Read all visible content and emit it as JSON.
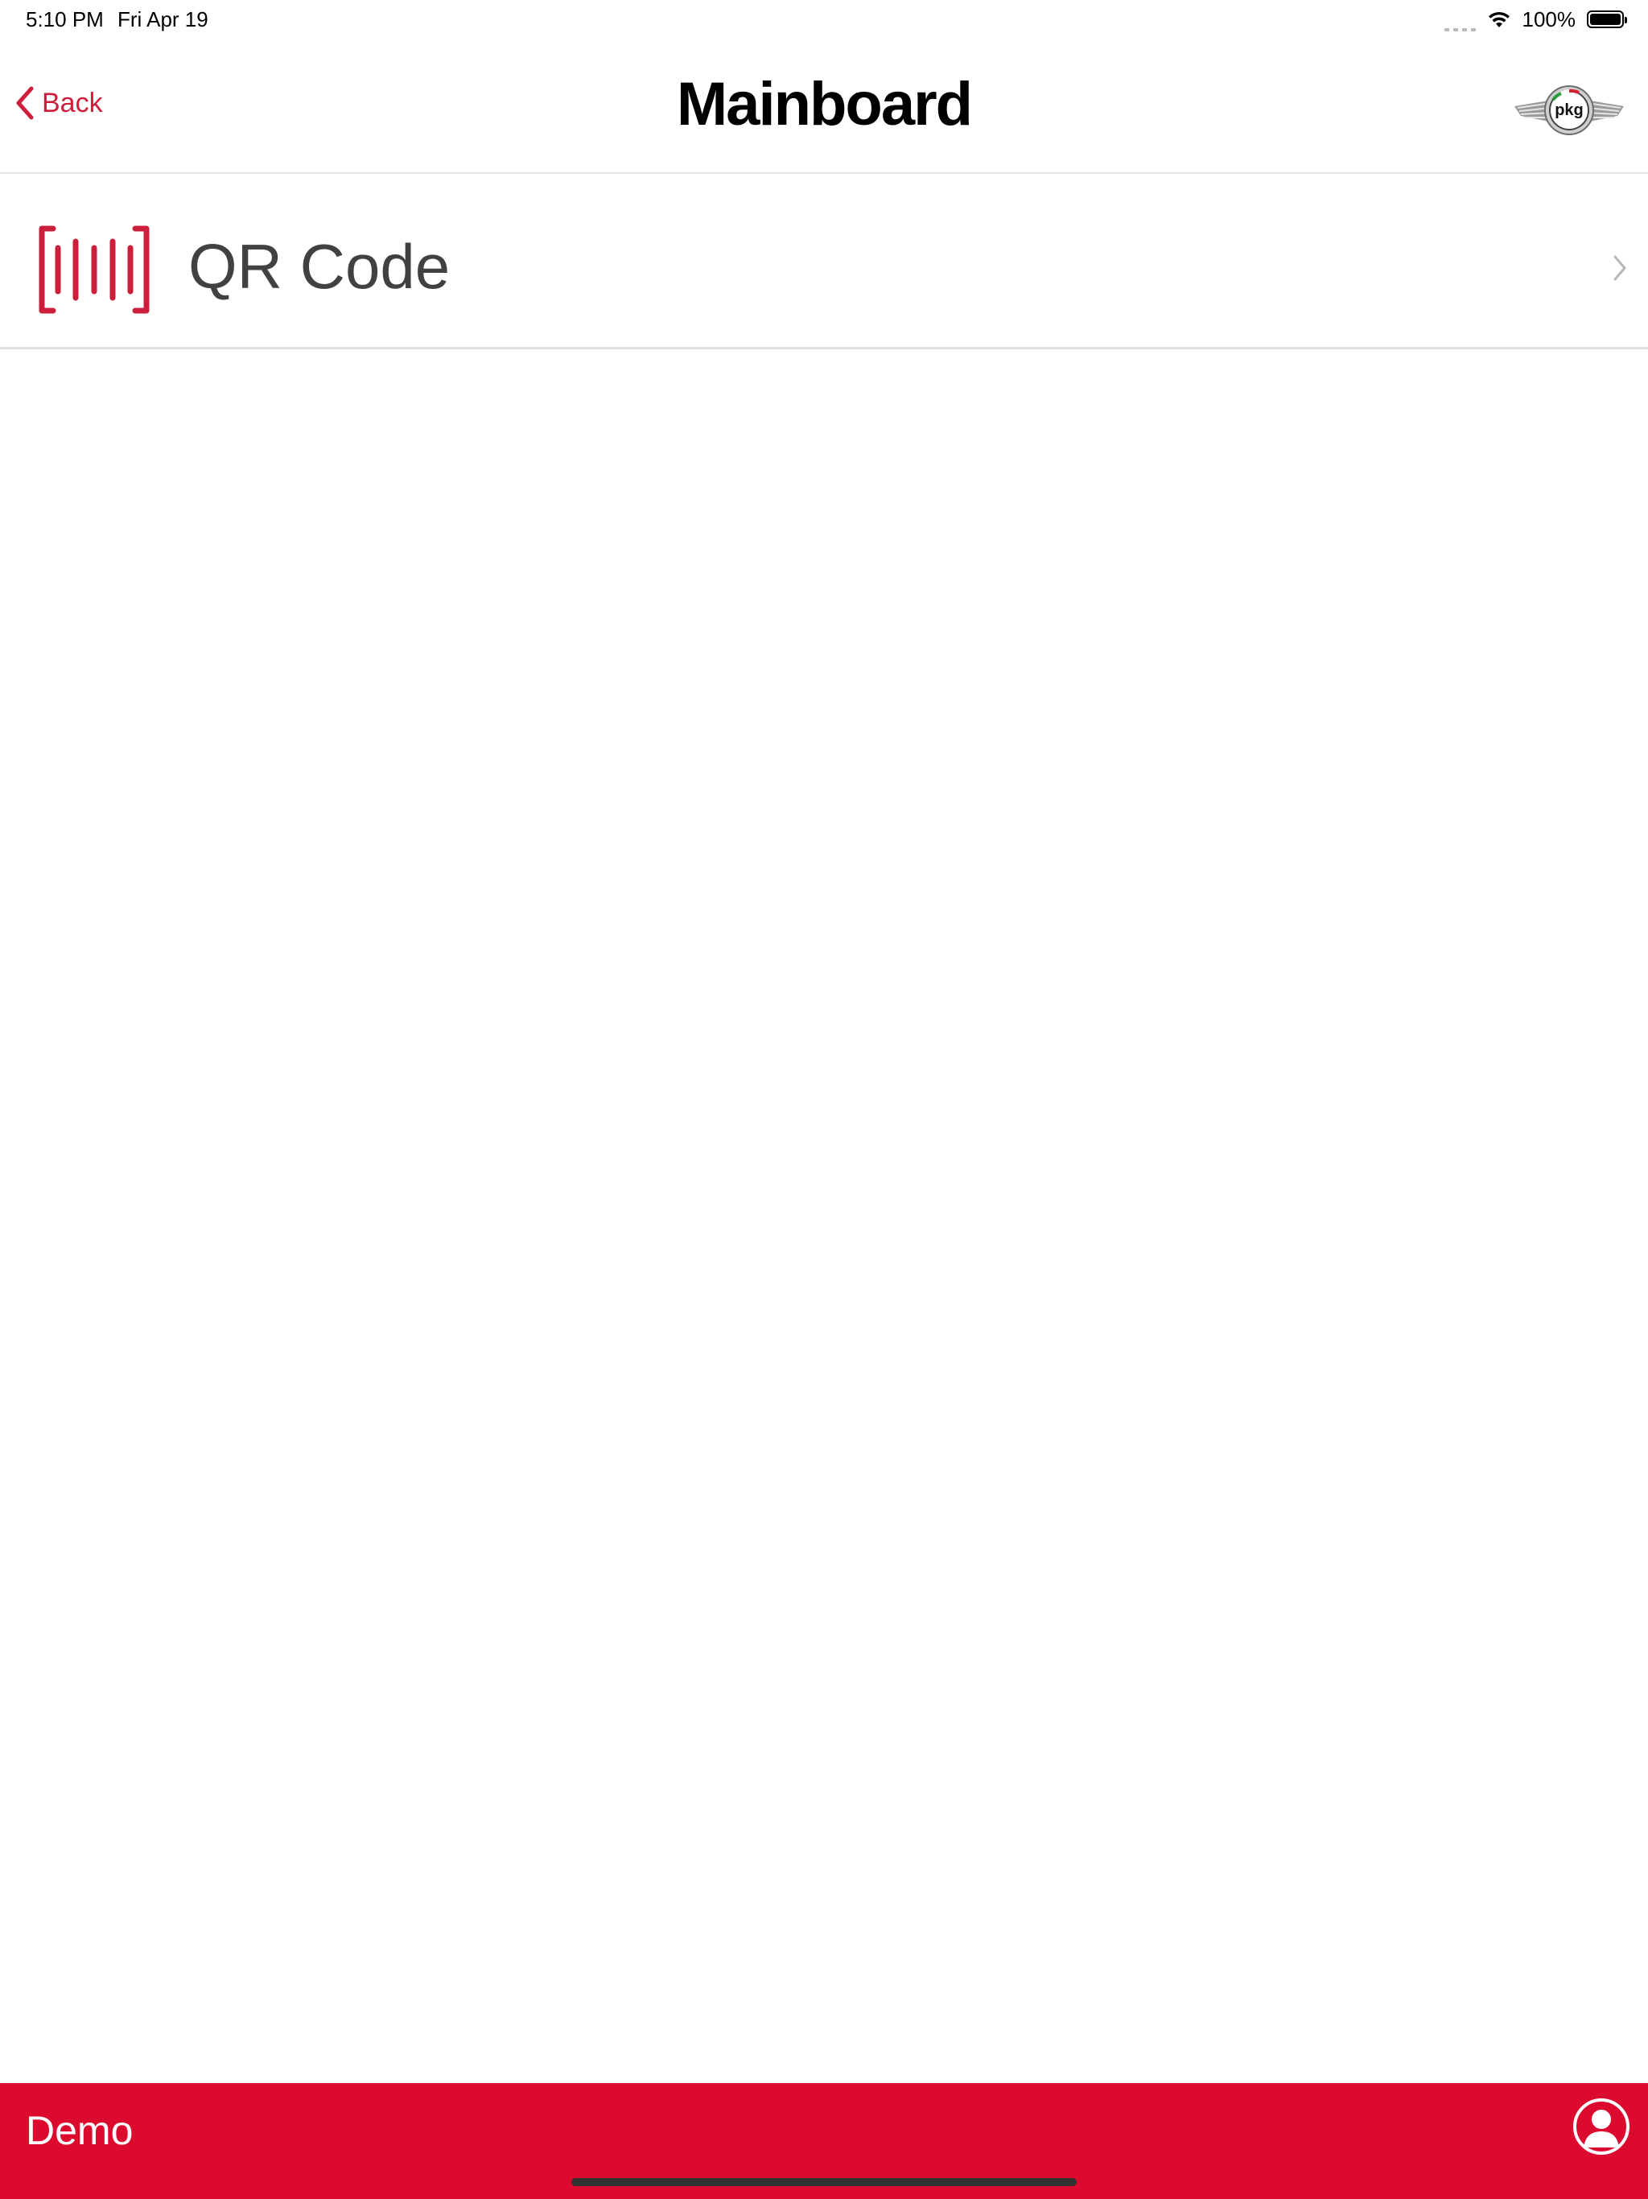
{
  "status_bar": {
    "time": "5:10 PM",
    "date": "Fri Apr 19",
    "battery_percent": "100%",
    "battery_level": 1.0,
    "icons": [
      "cellular-dots-icon",
      "wifi-icon",
      "battery-icon"
    ]
  },
  "nav": {
    "back_label": "Back",
    "title": "Mainboard",
    "back_icon": "chevron-left-icon",
    "logo_text": "pkg"
  },
  "list": {
    "items": [
      {
        "label": "QR Code",
        "icon": "barcode-scanner-icon",
        "accessory": "chevron-right-icon"
      }
    ]
  },
  "bottom_bar": {
    "label": "Demo",
    "icon": "user-profile-icon"
  },
  "colors": {
    "accent": "#cc1f3c",
    "bottom_bar": "#dd0a30",
    "title": "#000000",
    "row_text": "#414141",
    "separator": "#e0e0e0"
  }
}
